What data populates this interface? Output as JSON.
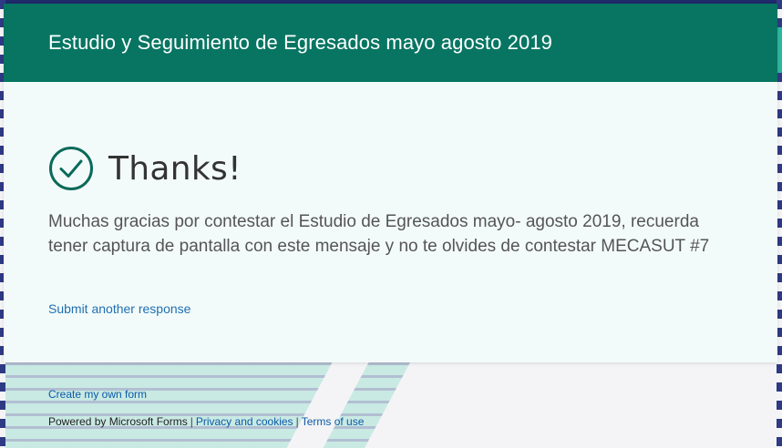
{
  "form": {
    "title": "Estudio y Seguimiento de Egresados mayo agosto 2019"
  },
  "confirmation": {
    "icon": "check-circle-icon",
    "heading": "Thanks!",
    "message": "Muchas gracias por contestar el Estudio de Egresados mayo- agosto 2019, recuerda tener captura de pantalla con este mensaje y no te olvides de contestar MECASUT #7",
    "submit_another": "Submit another response"
  },
  "footer": {
    "create_form": "Create my own form",
    "powered_by": "Powered by Microsoft Forms",
    "separator": "|",
    "privacy": "Privacy and cookies",
    "terms": "Terms of use"
  },
  "colors": {
    "header_bg": "#077562",
    "accent": "#0b6a5a",
    "link": "#1f6fb2"
  }
}
